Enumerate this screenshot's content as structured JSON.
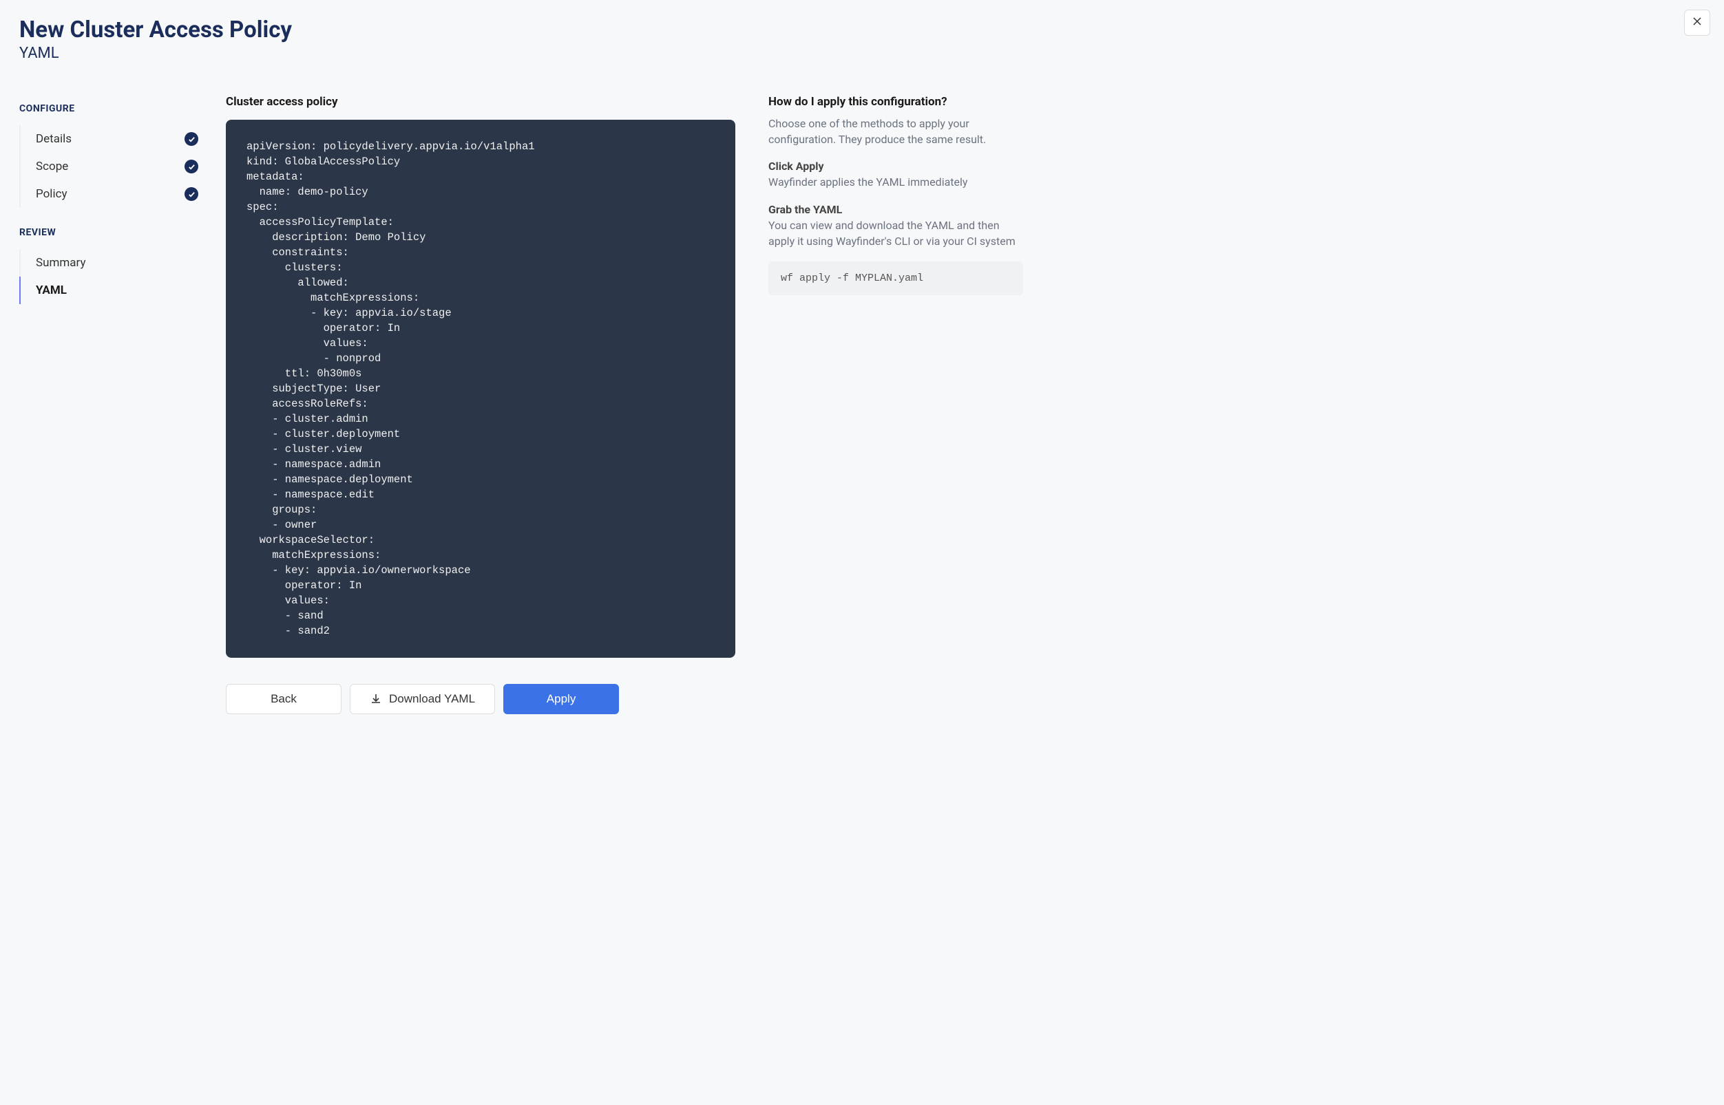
{
  "header": {
    "title": "New Cluster Access Policy",
    "subtitle": "YAML"
  },
  "sidebar": {
    "configure_label": "CONFIGURE",
    "review_label": "REVIEW",
    "configure_items": [
      {
        "label": "Details",
        "completed": true
      },
      {
        "label": "Scope",
        "completed": true
      },
      {
        "label": "Policy",
        "completed": true
      }
    ],
    "review_items": [
      {
        "label": "Summary",
        "active": false
      },
      {
        "label": "YAML",
        "active": true
      }
    ]
  },
  "main": {
    "heading": "Cluster access policy",
    "yaml": "apiVersion: policydelivery.appvia.io/v1alpha1\nkind: GlobalAccessPolicy\nmetadata:\n  name: demo-policy\nspec:\n  accessPolicyTemplate:\n    description: Demo Policy\n    constraints:\n      clusters:\n        allowed:\n          matchExpressions:\n          - key: appvia.io/stage\n            operator: In\n            values:\n            - nonprod\n      ttl: 0h30m0s\n    subjectType: User\n    accessRoleRefs:\n    - cluster.admin\n    - cluster.deployment\n    - cluster.view\n    - namespace.admin\n    - namespace.deployment\n    - namespace.edit\n    groups:\n    - owner\n  workspaceSelector:\n    matchExpressions:\n    - key: appvia.io/ownerworkspace\n      operator: In\n      values:\n      - sand\n      - sand2"
  },
  "buttons": {
    "back": "Back",
    "download": "Download YAML",
    "apply": "Apply"
  },
  "help": {
    "heading": "How do I apply this configuration?",
    "intro": "Choose one of the methods to apply your configuration. They produce the same result.",
    "method1_title": "Click Apply",
    "method1_body": "Wayfinder applies the YAML immediately",
    "method2_title": "Grab the YAML",
    "method2_body": "You can view and download the YAML and then apply it using Wayfinder's CLI or via your CI system",
    "cli_command": "wf apply -f MYPLAN.yaml"
  }
}
